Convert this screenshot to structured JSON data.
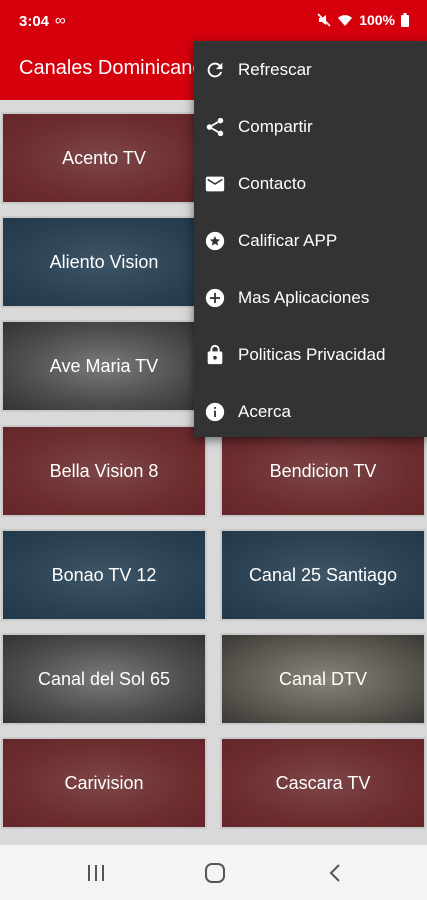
{
  "status": {
    "time": "3:04",
    "loop_glyph": "∞",
    "battery": "100%"
  },
  "app_bar": {
    "title": "Canales Dominicanos"
  },
  "menu": {
    "items": [
      {
        "label": "Refrescar",
        "icon": "refresh-icon"
      },
      {
        "label": "Compartir",
        "icon": "share-icon"
      },
      {
        "label": "Contacto",
        "icon": "mail-icon"
      },
      {
        "label": "Calificar APP",
        "icon": "star-badge-icon"
      },
      {
        "label": "Mas Aplicaciones",
        "icon": "add-circle-icon"
      },
      {
        "label": "Politicas Privacidad",
        "icon": "lock-icon"
      },
      {
        "label": "Acerca",
        "icon": "info-icon"
      }
    ]
  },
  "channels": [
    {
      "name": "Acento TV",
      "color": "red"
    },
    {
      "name": "",
      "color": "red"
    },
    {
      "name": "Aliento Vision",
      "color": "blue"
    },
    {
      "name": "",
      "color": "blue"
    },
    {
      "name": "Ave Maria TV",
      "color": "gray"
    },
    {
      "name": "",
      "color": "gray"
    },
    {
      "name": "Bella Vision 8",
      "color": "red"
    },
    {
      "name": "Bendicion TV",
      "color": "red"
    },
    {
      "name": "Bonao TV 12",
      "color": "blue"
    },
    {
      "name": "Canal 25 Santiago",
      "color": "blue"
    },
    {
      "name": "Canal del Sol 65",
      "color": "gray"
    },
    {
      "name": "Canal DTV",
      "color": "gray2"
    },
    {
      "name": "Carivision",
      "color": "red"
    },
    {
      "name": "Cascara TV",
      "color": "red"
    }
  ]
}
